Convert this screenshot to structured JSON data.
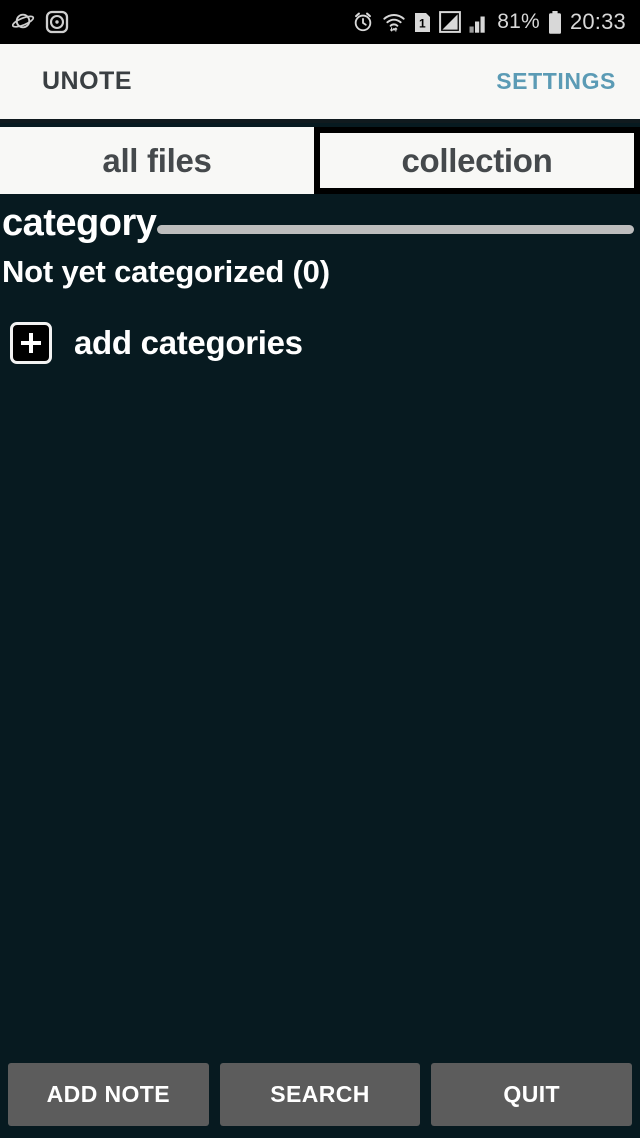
{
  "status_bar": {
    "left_icons": [
      {
        "name": "planet-icon",
        "glyph": "planet"
      },
      {
        "name": "disc-icon",
        "glyph": "disc"
      }
    ],
    "right_icons": [
      {
        "name": "alarm-clock-icon",
        "glyph": "alarm"
      },
      {
        "name": "wifi-icon",
        "glyph": "wifi"
      },
      {
        "name": "sim-card-icon",
        "glyph": "sim",
        "label": "1"
      },
      {
        "name": "signal-triangle-icon",
        "glyph": "triangle"
      },
      {
        "name": "signal-bars-icon",
        "glyph": "bars"
      }
    ],
    "battery_percent": "81%",
    "battery_icon": "battery-icon",
    "clock": "20:33",
    "background_color": "#000000",
    "text_color": "#d8d8d8"
  },
  "header": {
    "title": "UNOTE",
    "settings_label": "SETTINGS",
    "settings_color": "#5b9bb5",
    "background_color": "#f8f8f6",
    "title_color": "#3a3f42"
  },
  "tabs": [
    {
      "label": "all files",
      "name": "tab-all-files",
      "selected": false
    },
    {
      "label": "collection",
      "name": "tab-collection",
      "selected": true
    }
  ],
  "main": {
    "background_color": "#071a20",
    "category_title": "category",
    "rule_color": "#bdbdbd",
    "not_categorized_label": "Not yet categorized (0)",
    "add_categories_label": "add categories",
    "add_icon": "plus-icon"
  },
  "bottom_bar": {
    "buttons": [
      {
        "label": "ADD NOTE",
        "name": "add-note-button"
      },
      {
        "label": "SEARCH",
        "name": "search-button"
      },
      {
        "label": "QUIT",
        "name": "quit-button"
      }
    ],
    "button_color": "#5c5c5c"
  }
}
